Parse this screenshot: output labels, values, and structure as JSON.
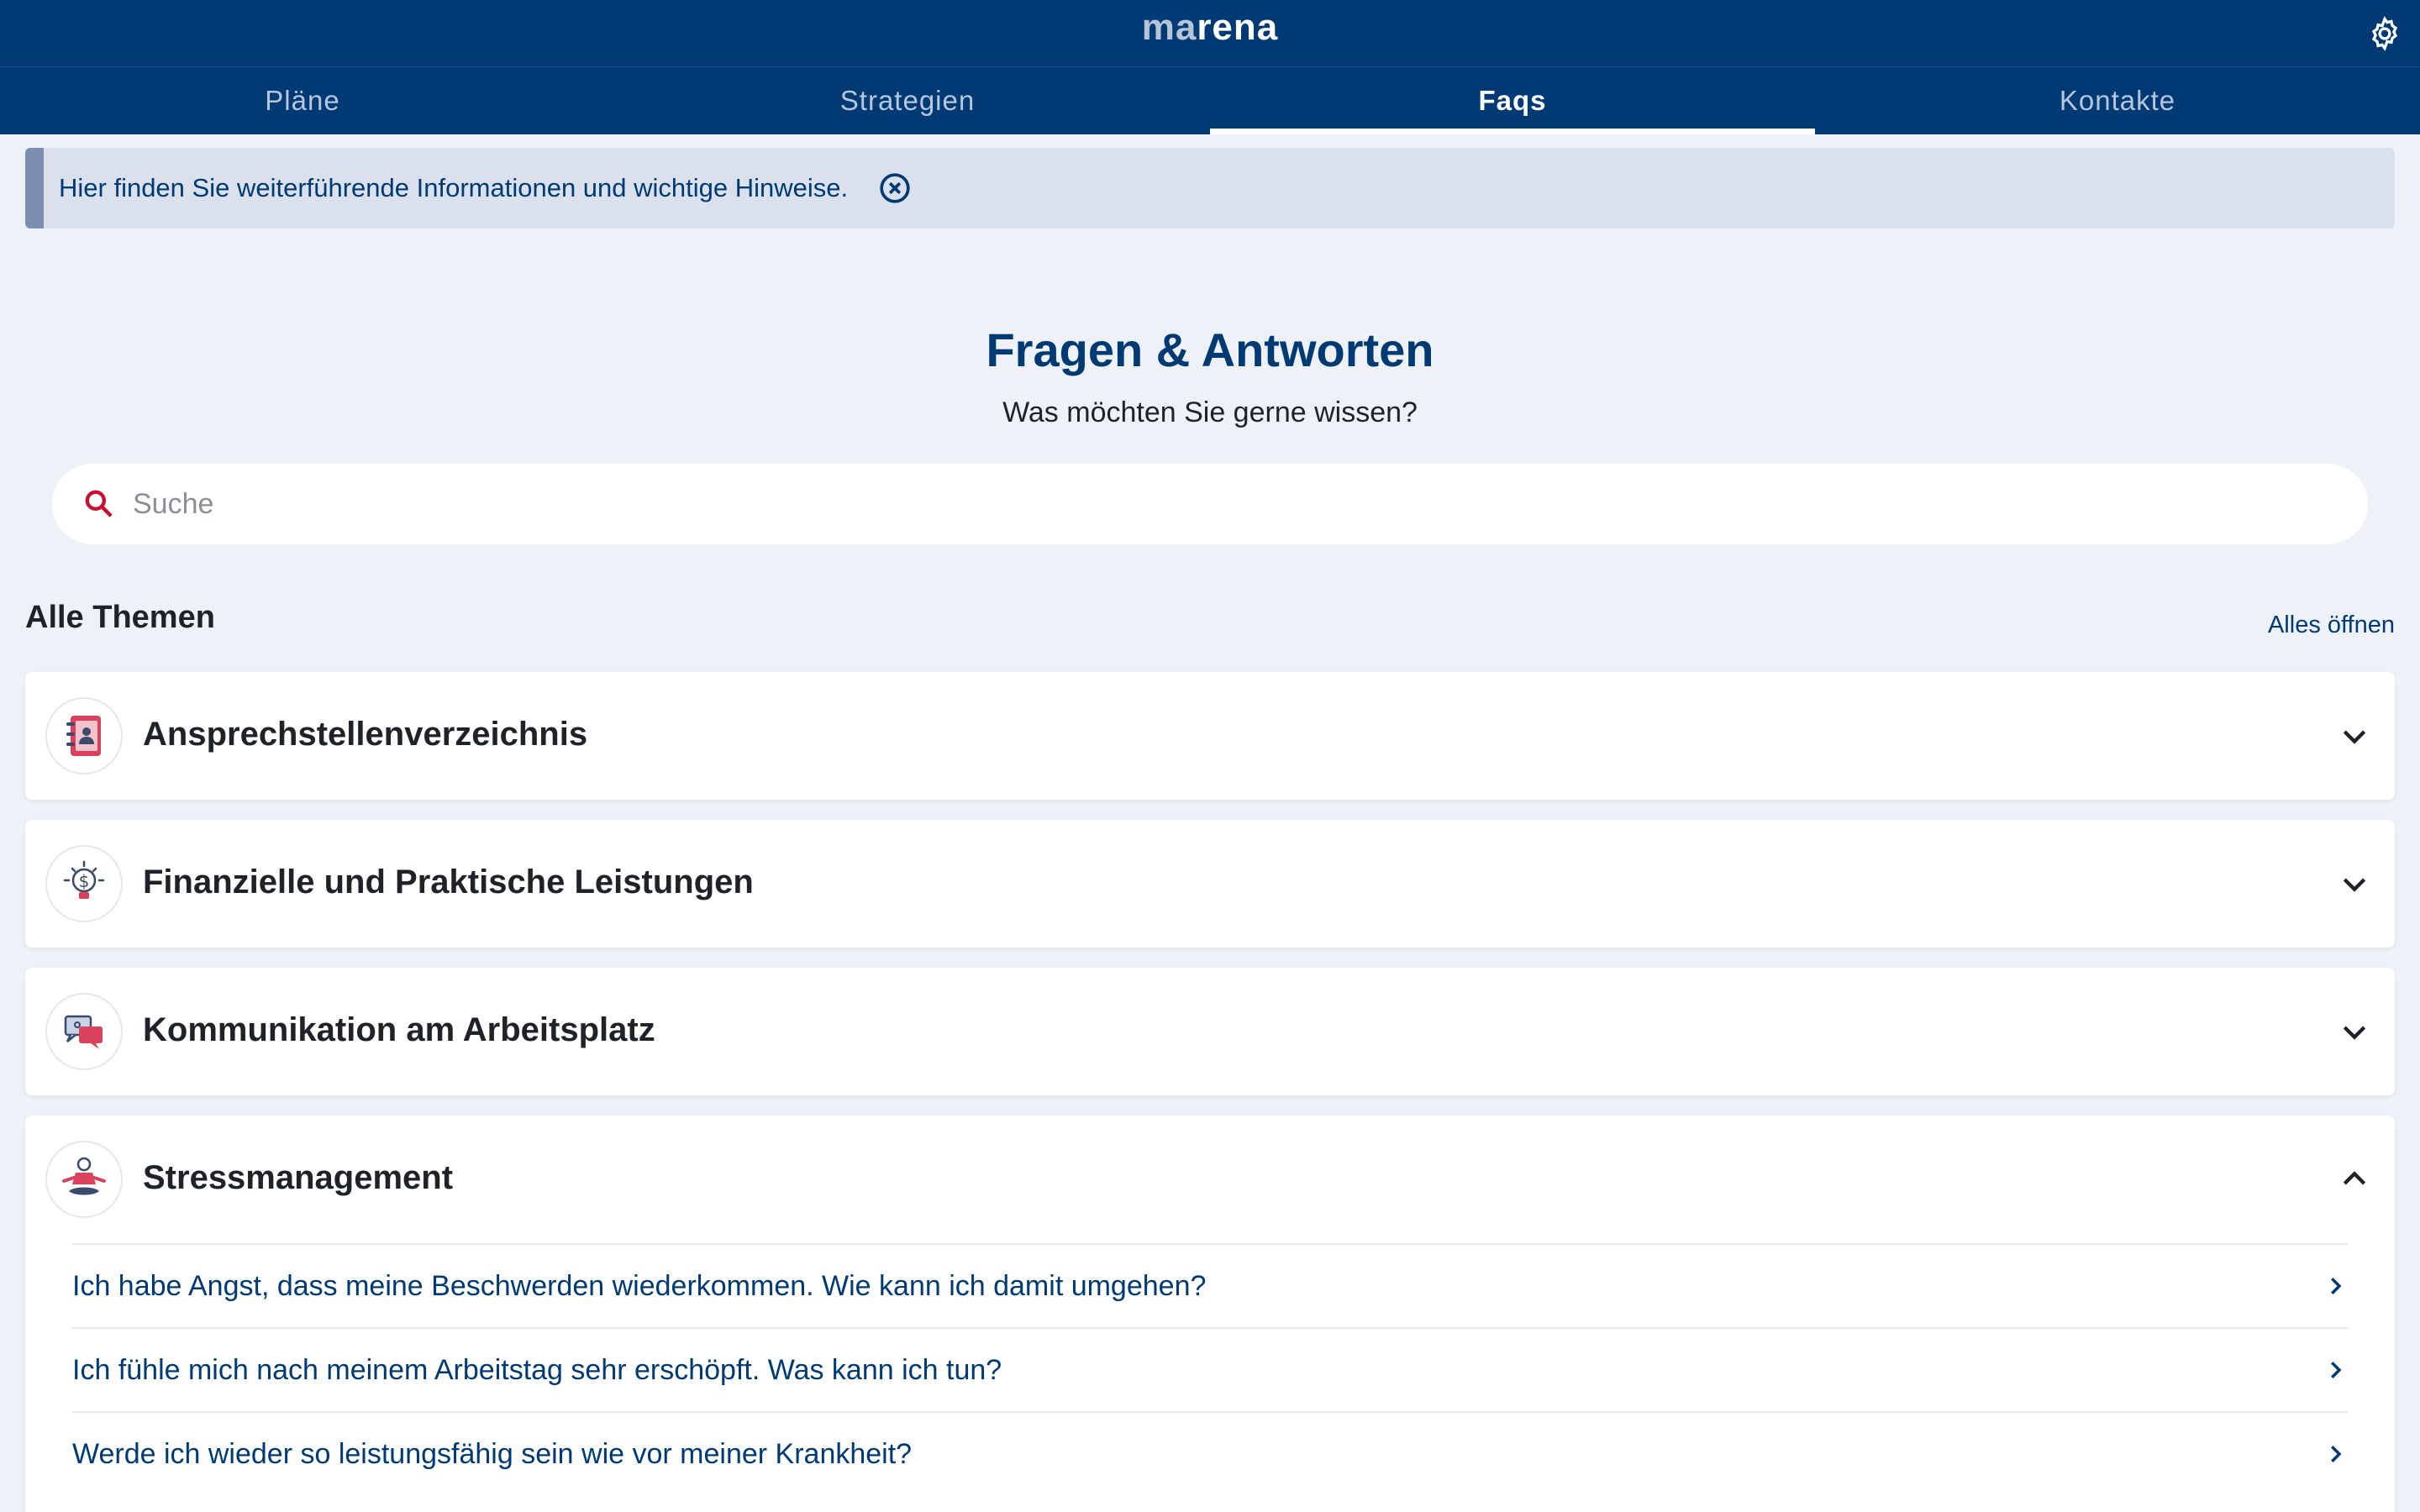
{
  "app": {
    "logo_prefix": "ma",
    "logo_suffix": "rena",
    "settings_icon": "gear-icon"
  },
  "tabs": [
    {
      "label": "Pläne",
      "active": false
    },
    {
      "label": "Strategien",
      "active": false
    },
    {
      "label": "Faqs",
      "active": true
    },
    {
      "label": "Kontakte",
      "active": false
    }
  ],
  "banner": {
    "text": "Hier finden Sie weiterführende Informationen und wichtige Hinweise.",
    "close_icon": "close-circle-icon"
  },
  "hero": {
    "title": "Fragen & Antworten",
    "subtitle": "Was möchten Sie gerne wissen?"
  },
  "search": {
    "placeholder": "Suche",
    "value": "",
    "icon": "search-icon"
  },
  "section": {
    "title": "Alle Themen",
    "open_all": "Alles öffnen"
  },
  "topics": [
    {
      "title": "Ansprechstellenverzeichnis",
      "icon": "address-book-icon",
      "expanded": false
    },
    {
      "title": "Finanzielle und Praktische Leistungen",
      "icon": "money-bulb-icon",
      "expanded": false
    },
    {
      "title": "Kommunikation am Arbeitsplatz",
      "icon": "chat-bubbles-icon",
      "expanded": false
    },
    {
      "title": "Stressmanagement",
      "icon": "meditation-icon",
      "expanded": true,
      "questions": [
        "Ich habe Angst, dass meine Beschwerden wiederkommen. Wie kann ich damit umgehen?",
        "Ich fühle mich nach meinem Arbeitstag sehr erschöpft. Was kann ich tun?",
        "Werde ich wieder so leistungsfähig sein wie vor meiner Krankheit?"
      ]
    }
  ],
  "colors": {
    "brand": "#003a75",
    "accent": "#c8102e",
    "background": "#eef1f7",
    "banner": "#dbe1ec"
  }
}
